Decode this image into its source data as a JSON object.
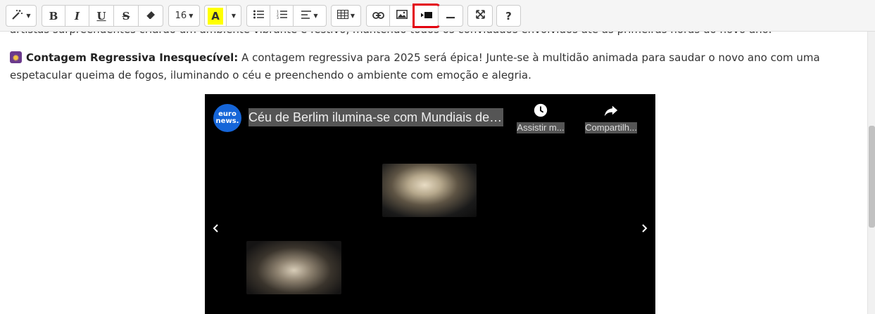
{
  "content": {
    "cut_line_text": "artistas surpreendentes criarão um ambiente vibrante e festivo, mantendo todos os convidados envolvidos até as primeiras horas do novo ano.",
    "paragraph": {
      "emoji_icon": "fireworks-emoji",
      "heading": "Contagem Regressiva Inesquecível:",
      "body": " A contagem regressiva para 2025 será épica! Junte-se à multidão animada para saudar o novo ano com uma espetacular queima de fogos, iluminando o céu e preenchendo o ambiente com emoção e alegria."
    },
    "video": {
      "channel_line1": "euro",
      "channel_line2": "news.",
      "title": "Céu de Berlim ilumina-se com Mundiais de f...",
      "watch_label": "Assistir m...",
      "share_label": "Compartilh..."
    }
  },
  "toolbar": {
    "font_size": "16",
    "bold_label": "B",
    "italic_label": "I",
    "underline_label": "U",
    "strike_label": "S",
    "highlight_label": "A",
    "help_label": "?",
    "highlight_color": "#ffff00",
    "active_outline_color": "#e3000f"
  },
  "scroll": {
    "position_fraction": 0.52
  }
}
